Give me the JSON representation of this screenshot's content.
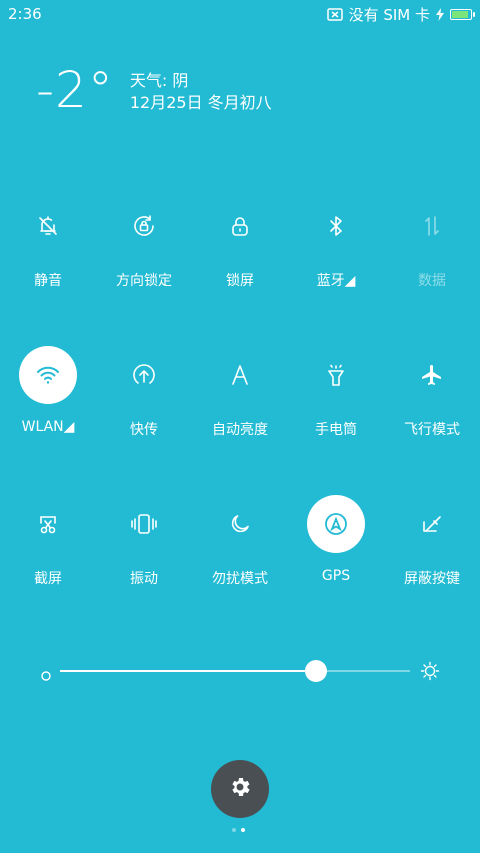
{
  "status": {
    "time": "2:36",
    "sim_text": "没有 SIM 卡",
    "battery_level": 0.9,
    "battery_color": "#7BE57B"
  },
  "weather": {
    "temperature": "-2°",
    "condition": "天气: 阴",
    "date": "12月25日 冬月初八"
  },
  "rows": [
    [
      {
        "name": "mute",
        "label": "静音",
        "icon": "bell-off-icon",
        "active": false,
        "dim": false
      },
      {
        "name": "rotation-lock",
        "label": "方向锁定",
        "icon": "rotation-lock-icon",
        "active": false,
        "dim": false
      },
      {
        "name": "lock-screen",
        "label": "锁屏",
        "icon": "lock-icon",
        "active": false,
        "dim": false
      },
      {
        "name": "bluetooth",
        "label": "蓝牙◢",
        "icon": "bluetooth-icon",
        "active": false,
        "dim": false
      },
      {
        "name": "data",
        "label": "数据",
        "icon": "data-arrows-icon",
        "active": false,
        "dim": true
      }
    ],
    [
      {
        "name": "wlan",
        "label": "WLAN◢",
        "icon": "wifi-icon",
        "active": true,
        "dim": false
      },
      {
        "name": "quick-share",
        "label": "快传",
        "icon": "upload-circle-icon",
        "active": false,
        "dim": false
      },
      {
        "name": "auto-brightness",
        "label": "自动亮度",
        "icon": "letter-a-icon",
        "active": false,
        "dim": false
      },
      {
        "name": "flashlight",
        "label": "手电筒",
        "icon": "flashlight-icon",
        "active": false,
        "dim": false
      },
      {
        "name": "airplane",
        "label": "飞行模式",
        "icon": "airplane-icon",
        "active": false,
        "dim": false
      }
    ],
    [
      {
        "name": "screenshot",
        "label": "截屏",
        "icon": "scissors-icon",
        "active": false,
        "dim": false
      },
      {
        "name": "vibrate",
        "label": "振动",
        "icon": "vibrate-icon",
        "active": false,
        "dim": false
      },
      {
        "name": "do-not-disturb",
        "label": "勿扰模式",
        "icon": "moon-icon",
        "active": false,
        "dim": false
      },
      {
        "name": "gps",
        "label": "GPS",
        "icon": "gps-icon",
        "active": true,
        "dim": false
      },
      {
        "name": "disable-keys",
        "label": "屏蔽按键",
        "icon": "keys-off-icon",
        "active": false,
        "dim": false
      }
    ]
  ],
  "brightness": {
    "level": 0.73
  },
  "pages": {
    "count": 2,
    "current": 1
  },
  "colors": {
    "background": "#22BBD3",
    "active_icon": "#22BBD3",
    "settings_bg": "#4A4F54"
  }
}
